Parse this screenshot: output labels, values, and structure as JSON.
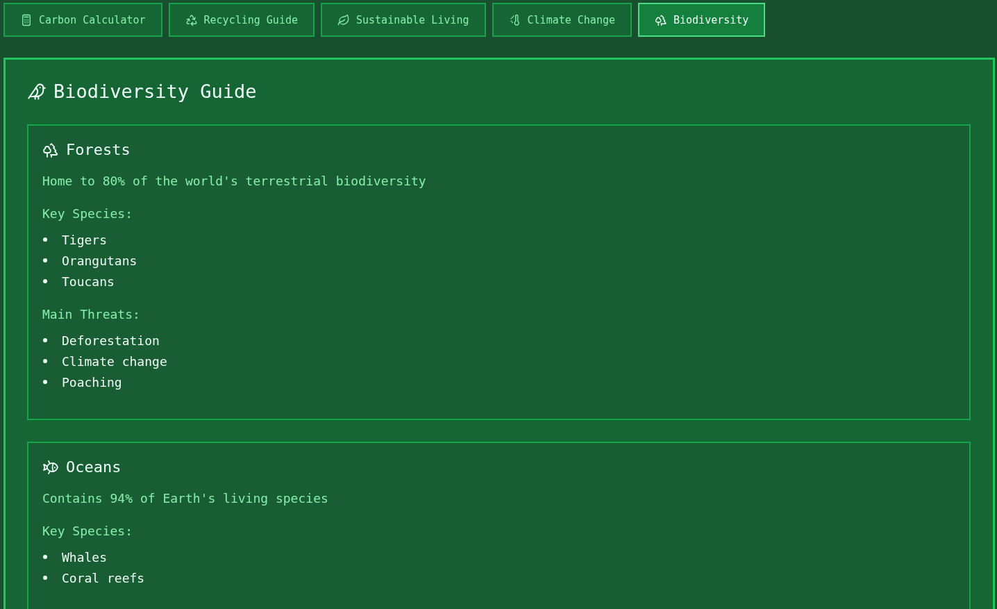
{
  "tabs": [
    {
      "label": "Carbon Calculator",
      "selected": false
    },
    {
      "label": "Recycling Guide",
      "selected": false
    },
    {
      "label": "Sustainable Living",
      "selected": false
    },
    {
      "label": "Climate Change",
      "selected": false
    },
    {
      "label": "Biodiversity",
      "selected": true
    }
  ],
  "guide": {
    "title": "Biodiversity Guide",
    "sections": [
      {
        "name": "Forests",
        "fact": "Home to 80% of the world's terrestrial biodiversity",
        "groups": [
          {
            "heading": "Key Species:",
            "items": [
              "Tigers",
              "Orangutans",
              "Toucans"
            ]
          },
          {
            "heading": "Main Threats:",
            "items": [
              "Deforestation",
              "Climate change",
              "Poaching"
            ]
          }
        ]
      },
      {
        "name": "Oceans",
        "fact": "Contains 94% of Earth's living species",
        "groups": [
          {
            "heading": "Key Species:",
            "items": [
              "Whales",
              "Coral reefs"
            ]
          }
        ]
      }
    ]
  }
}
